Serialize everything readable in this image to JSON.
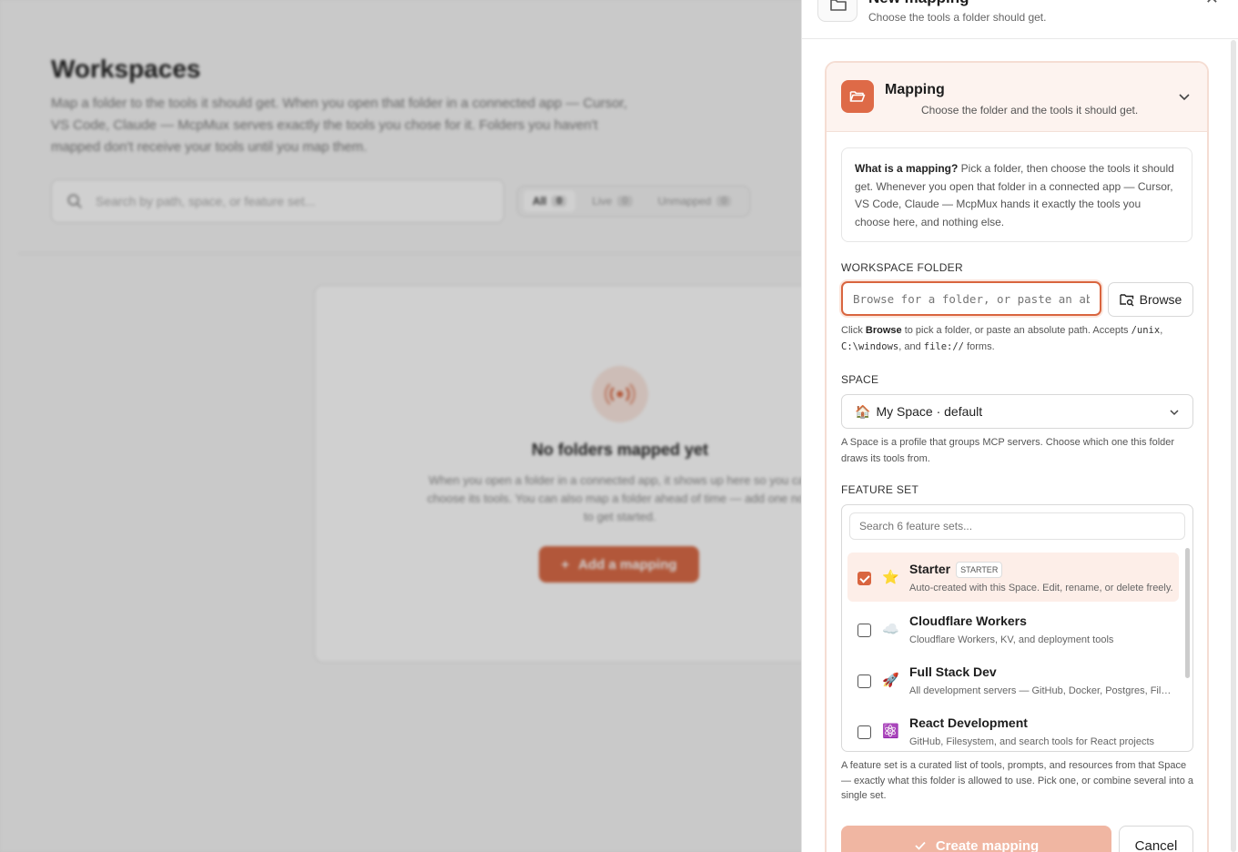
{
  "background": {
    "title": "Workspaces",
    "description": "Map a folder to the tools it should get. When you open that folder in a connected app — Cursor, VS Code, Claude — McpMux serves exactly the tools you chose for it. Folders you haven't mapped don't receive your tools until you map them.",
    "search_placeholder": "Search by path, space, or feature set...",
    "filters": [
      {
        "label": "All",
        "count": "0"
      },
      {
        "label": "Live",
        "count": "0"
      },
      {
        "label": "Unmapped",
        "count": "0"
      }
    ],
    "empty_title": "No folders mapped yet",
    "empty_desc": "When you open a folder in a connected app, it shows up here so you can choose its tools. You can also map a folder ahead of time — add one now to get started.",
    "add_button": "Add a mapping"
  },
  "drawer": {
    "title": "New mapping",
    "subtitle": "Choose the tools a folder should get.",
    "close": "✕",
    "section": {
      "title": "Mapping",
      "subtitle": "Choose the folder and the tools it should get."
    },
    "info": {
      "lead": "What is a mapping?",
      "text": " Pick a folder, then choose the tools it should get. Whenever you open that folder in a connected app — Cursor, VS Code, Claude — McpMux hands it exactly the tools you choose here, and nothing else."
    },
    "folder": {
      "label": "WORKSPACE FOLDER",
      "placeholder": "Browse for a folder, or paste an absolute path",
      "browse": "Browse",
      "hint_pre": "Click ",
      "hint_bold": "Browse",
      "hint_mid": " to pick a folder, or paste an absolute path. Accepts ",
      "code1": "/unix",
      "sep1": ", ",
      "code2": "C:\\windows",
      "sep2": ", and ",
      "code3": "file://",
      "hint_end": " forms."
    },
    "space": {
      "label": "SPACE",
      "emoji": "🏠",
      "value": "My Space · default",
      "hint": "A Space is a profile that groups MCP servers. Choose which one this folder draws its tools from."
    },
    "feature_set": {
      "label": "FEATURE SET",
      "search_placeholder": "Search 6 feature sets...",
      "items": [
        {
          "name": "Starter",
          "badge": "STARTER",
          "emoji": "⭐",
          "desc": "Auto-created with this Space. Edit, rename, or delete freely.",
          "checked": true
        },
        {
          "name": "Cloudflare Workers",
          "badge": "",
          "emoji": "☁️",
          "desc": "Cloudflare Workers, KV, and deployment tools",
          "checked": false
        },
        {
          "name": "Full Stack Dev",
          "badge": "",
          "emoji": "🚀",
          "desc": "All development servers — GitHub, Docker, Postgres, Filesystem",
          "checked": false
        },
        {
          "name": "React Development",
          "badge": "",
          "emoji": "⚛️",
          "desc": "GitHub, Filesystem, and search tools for React projects",
          "checked": false
        }
      ],
      "hint": "A feature set is a curated list of tools, prompts, and resources from that Space — exactly what this folder is allowed to use. Pick one, or combine several into a single set."
    },
    "create": "Create mapping",
    "cancel": "Cancel"
  },
  "colors": {
    "accent": "#d9653f",
    "accent_light": "#fdeee8"
  }
}
